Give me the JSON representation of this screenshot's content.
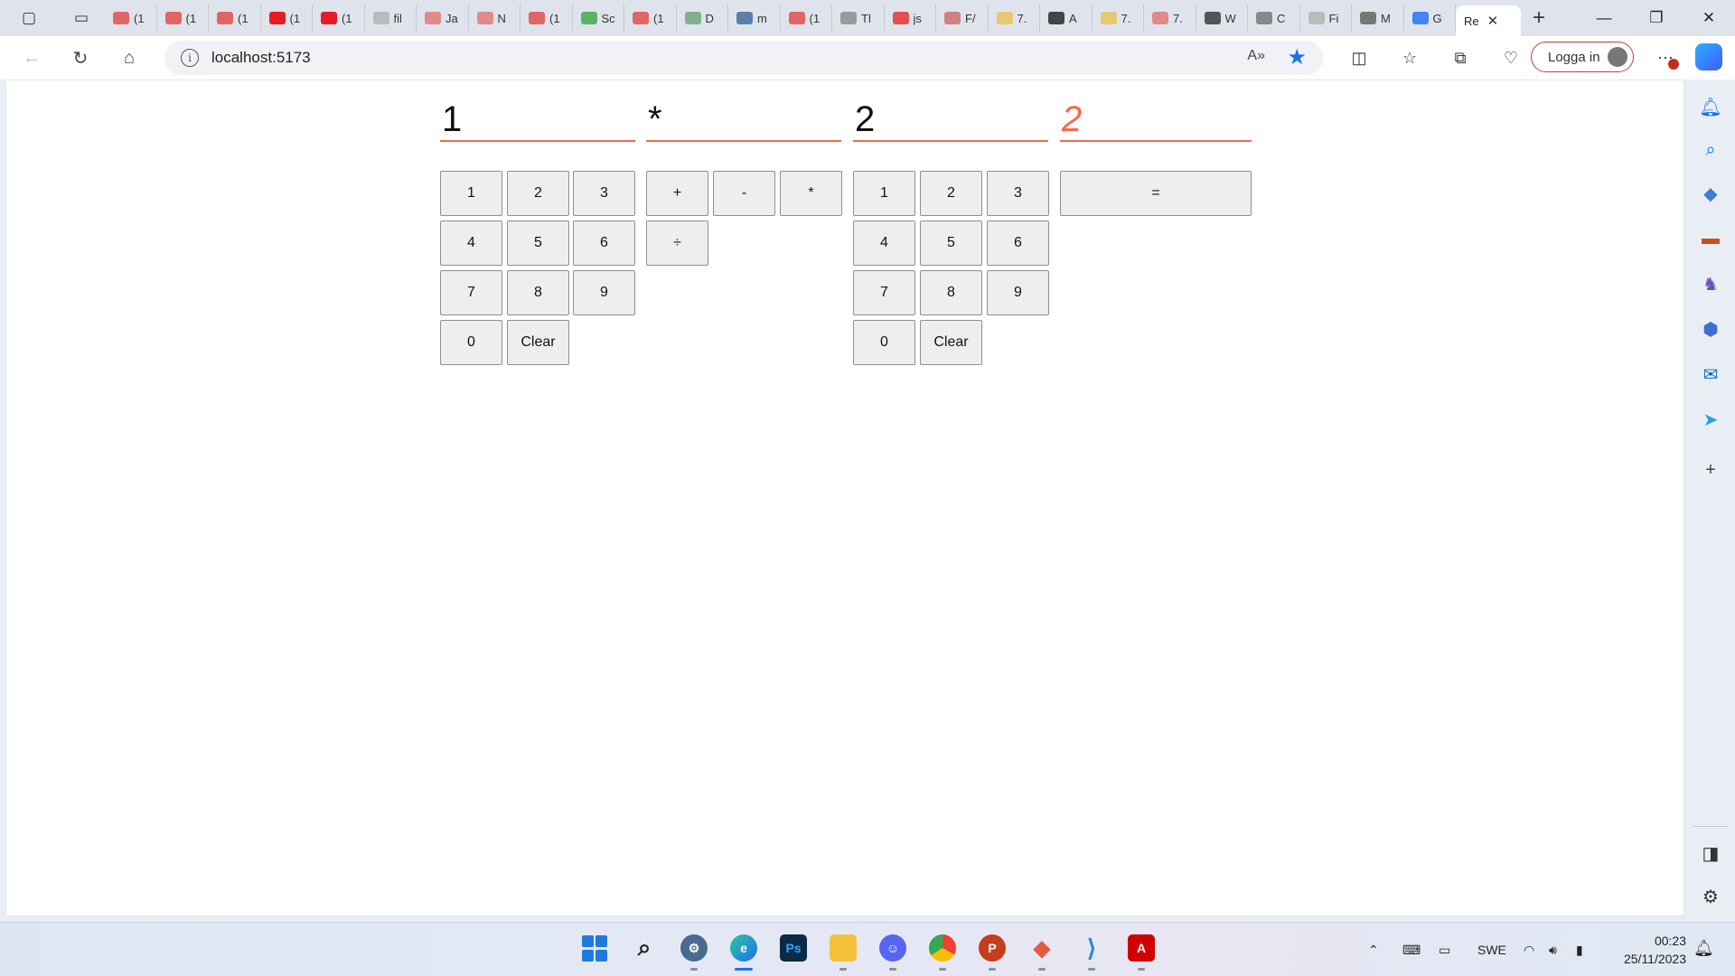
{
  "browser": {
    "tabs": [
      {
        "label": "(1",
        "color": "#e06666"
      },
      {
        "label": "(1",
        "color": "#e06666"
      },
      {
        "label": "(1",
        "color": "#e06666"
      },
      {
        "label": "(1",
        "color": "#e51c23"
      },
      {
        "label": "(1",
        "color": "#e51c23"
      },
      {
        "label": "fil",
        "color": "#bbbbbb"
      },
      {
        "label": "Ja",
        "color": "#e08a8a"
      },
      {
        "label": "N",
        "color": "#e08a8a"
      },
      {
        "label": "(1",
        "color": "#e06666"
      },
      {
        "label": "Sc",
        "color": "#58b368"
      },
      {
        "label": "(1",
        "color": "#e06666"
      },
      {
        "label": "D",
        "color": "#7fb08a"
      },
      {
        "label": "m",
        "color": "#5b7fa6"
      },
      {
        "label": "(1",
        "color": "#e06666"
      },
      {
        "label": "Tl",
        "color": "#9a9a9a"
      },
      {
        "label": "js",
        "color": "#e05050"
      },
      {
        "label": "F/",
        "color": "#d08080"
      },
      {
        "label": "7.",
        "color": "#e8c870"
      },
      {
        "label": "A",
        "color": "#444444"
      },
      {
        "label": "7.",
        "color": "#e8c870"
      },
      {
        "label": "7.",
        "color": "#e08a8a"
      },
      {
        "label": "W",
        "color": "#555555"
      },
      {
        "label": "C",
        "color": "#888888"
      },
      {
        "label": "Fi",
        "color": "#bbbbbb"
      },
      {
        "label": "M",
        "color": "#777777"
      },
      {
        "label": "G",
        "color": "#4285f4"
      }
    ],
    "active_tab": {
      "label": "Re",
      "close": "✕"
    },
    "new_tab": "+",
    "url": "localhost:5173",
    "login_label": "Logga in"
  },
  "calculator": {
    "operand1": "1",
    "operator": "*",
    "operand2": "2",
    "result": "2",
    "digit_keys": [
      "1",
      "2",
      "3",
      "4",
      "5",
      "6",
      "7",
      "8",
      "9",
      "0"
    ],
    "clear_label": "Clear",
    "operator_keys": [
      "+",
      "-",
      "*",
      "÷"
    ],
    "equals_label": "="
  },
  "taskbar": {
    "language": "SWE",
    "time": "00:23",
    "date": "25/11/2023"
  },
  "colors": {
    "accent": "#f26b4f",
    "key_bg": "#eeeeee",
    "key_border": "#8e8e8e"
  }
}
